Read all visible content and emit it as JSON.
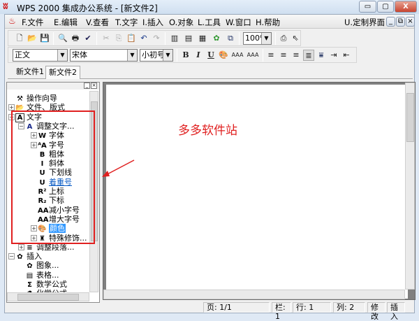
{
  "window": {
    "title": "WPS 2000 集成办公系统 - [新文件2]",
    "min": "▭",
    "max": "▢",
    "close": "X"
  },
  "menu": {
    "items": [
      "F.文件",
      "E.编辑",
      "V.查看",
      "T.文字",
      "I.插入",
      "O.对象",
      "L.工具",
      "W.窗口",
      "H.帮助"
    ],
    "customize": "U.定制界面",
    "mdi_min": "_",
    "mdi_restore": "⧉",
    "mdi_close": "×"
  },
  "toolbar": {
    "zoom": "100%"
  },
  "format": {
    "style": "正文",
    "font": "宋体",
    "size": "小初号",
    "bold": "B",
    "italic": "I",
    "underline": "U",
    "shrink": "AAA",
    "grow": "AAA"
  },
  "tabs": [
    "新文件1",
    "新文件2"
  ],
  "tree": [
    {
      "label": "操作向导",
      "icon": "wizard-icon",
      "glyph": "⚒",
      "lvl": 0
    },
    {
      "label": "文件、版式",
      "icon": "folder-icon",
      "glyph": "📂",
      "lvl": 0,
      "pm": "+"
    },
    {
      "label": "文字",
      "icon": "text-icon",
      "glyph": "A",
      "lvl": 0,
      "pm": "-"
    },
    {
      "label": "调整文字...",
      "icon": "font-a-icon",
      "glyph": "A",
      "lvl": 1,
      "pm": "-"
    },
    {
      "label": "字体",
      "icon": "font-icon",
      "glyph": "W",
      "lvl": 2,
      "pm": "+"
    },
    {
      "label": "字号",
      "icon": "font-size-icon",
      "glyph": "ᴬA",
      "lvl": 2,
      "pm": "+"
    },
    {
      "label": "粗体",
      "icon": "bold-icon",
      "glyph": "B",
      "lvl": 2
    },
    {
      "label": "斜体",
      "icon": "italic-icon",
      "glyph": "I",
      "lvl": 2
    },
    {
      "label": "下划线",
      "icon": "underline-icon",
      "glyph": "U",
      "lvl": 2
    },
    {
      "label": "着重号",
      "icon": "emphasis-icon",
      "glyph": "U",
      "lvl": 2,
      "link": true
    },
    {
      "label": "上标",
      "icon": "superscript-icon",
      "glyph": "R²",
      "lvl": 2
    },
    {
      "label": "下标",
      "icon": "subscript-icon",
      "glyph": "R₂",
      "lvl": 2
    },
    {
      "label": "减小字号",
      "icon": "shrink-font-icon",
      "glyph": "AA",
      "lvl": 2
    },
    {
      "label": "增大字号",
      "icon": "grow-font-icon",
      "glyph": "AA",
      "lvl": 2
    },
    {
      "label": "颜色",
      "icon": "color-palette-icon",
      "glyph": "🎨",
      "lvl": 2,
      "pm": "+",
      "sel": true
    },
    {
      "label": "特殊修饰...",
      "icon": "decoration-icon",
      "glyph": "♜",
      "lvl": 2,
      "pm": "+"
    },
    {
      "label": "调整段落...",
      "icon": "paragraph-icon",
      "glyph": "≡",
      "lvl": 1,
      "pm": "+"
    },
    {
      "label": "插入",
      "icon": "insert-icon",
      "glyph": "✿",
      "lvl": 0,
      "pm": "-"
    },
    {
      "label": "图象...",
      "icon": "image-icon",
      "glyph": "✿",
      "lvl": 1
    },
    {
      "label": "表格...",
      "icon": "table-icon",
      "glyph": "▤",
      "lvl": 1
    },
    {
      "label": "数学公式",
      "icon": "formula-icon",
      "glyph": "Σ",
      "lvl": 1
    },
    {
      "label": "化学公式",
      "icon": "chem-icon",
      "glyph": "⚗",
      "lvl": 1
    }
  ],
  "annotation": {
    "text": "多多软件站",
    "color": "#e02020"
  },
  "status": {
    "page": "页: 1/1",
    "column": "栏: 1",
    "row": "行: 1",
    "col": "列: 2",
    "modify": "修改",
    "insert": "插入"
  }
}
